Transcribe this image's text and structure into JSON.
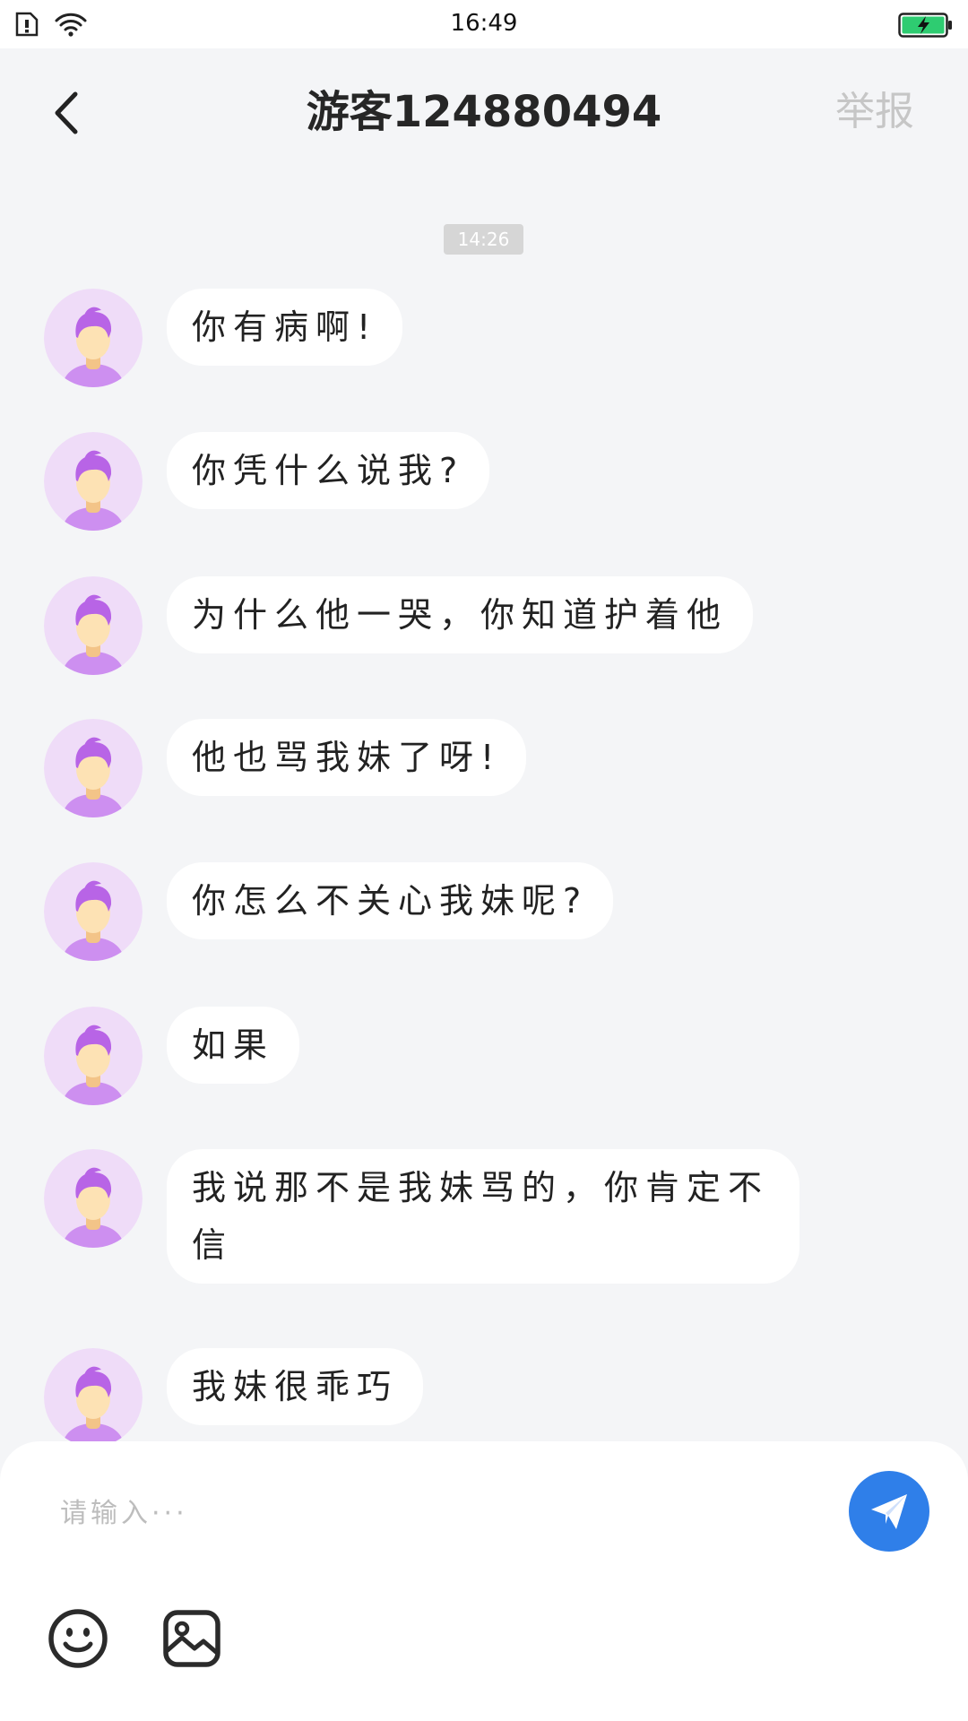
{
  "status_bar": {
    "time": "16:49",
    "icons": [
      "sim-alert-icon",
      "wifi-icon",
      "battery-charging-icon"
    ],
    "battery_color": "#2ecc71"
  },
  "header": {
    "back_icon": "chevron-left-icon",
    "title": "游客124880494",
    "report_label": "举报"
  },
  "chat": {
    "timestamp": "14:26",
    "messages": [
      {
        "text": "你有病啊!"
      },
      {
        "text": "你凭什么说我?"
      },
      {
        "text": "为什么他一哭，你知道护着他"
      },
      {
        "text": "他也骂我妹了呀!"
      },
      {
        "text": "你怎么不关心我妹呢?"
      },
      {
        "text": "如果"
      },
      {
        "text": "我说那不是我妹骂的，你肯定不信"
      },
      {
        "text": "我妹很乖巧"
      }
    ]
  },
  "composer": {
    "placeholder": "请输入···",
    "send_icon": "paper-plane-icon",
    "tools": [
      "emoji-icon",
      "image-icon"
    ]
  },
  "colors": {
    "background": "#f4f5f7",
    "bubble": "#ffffff",
    "accent": "#2f7fe9",
    "report_text": "#c6c6c6",
    "timestamp_pill": "#d6d6d6"
  }
}
